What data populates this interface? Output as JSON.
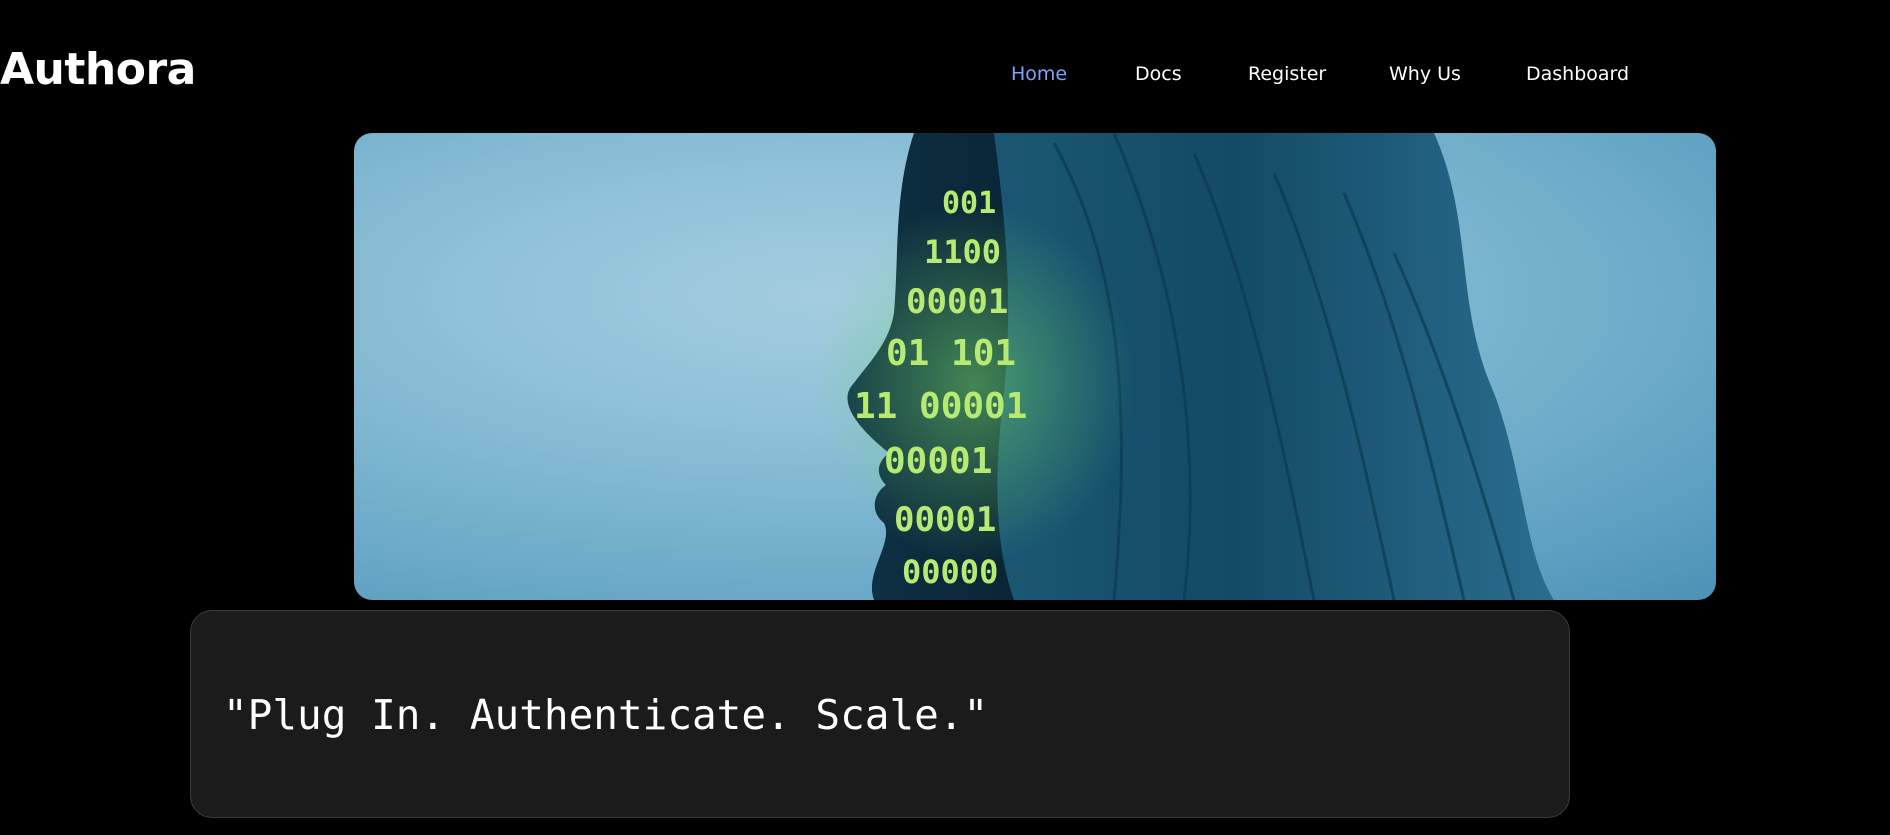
{
  "brand": {
    "name": "Authora"
  },
  "nav": {
    "items": [
      {
        "label": "Home",
        "active": true
      },
      {
        "label": "Docs",
        "active": false
      },
      {
        "label": "Register",
        "active": false
      },
      {
        "label": "Why Us",
        "active": false
      },
      {
        "label": "Dashboard",
        "active": false
      }
    ]
  },
  "hero": {
    "image": "profile-face-binary-projection",
    "colors": {
      "background": "#8fc1d8",
      "hair": "#0f3f57",
      "binary_text": "#a8e36a"
    },
    "binary_lines": [
      "001",
      "1100",
      "00001",
      "01 101",
      "11 00001",
      "00001",
      "00001",
      "00000"
    ]
  },
  "tagline": {
    "text": "\"Plug In. Authenticate. Scale.\""
  },
  "colors": {
    "page_background": "#000000",
    "nav_active": "#7aa3ff",
    "card_background": "#1b1b1b"
  }
}
